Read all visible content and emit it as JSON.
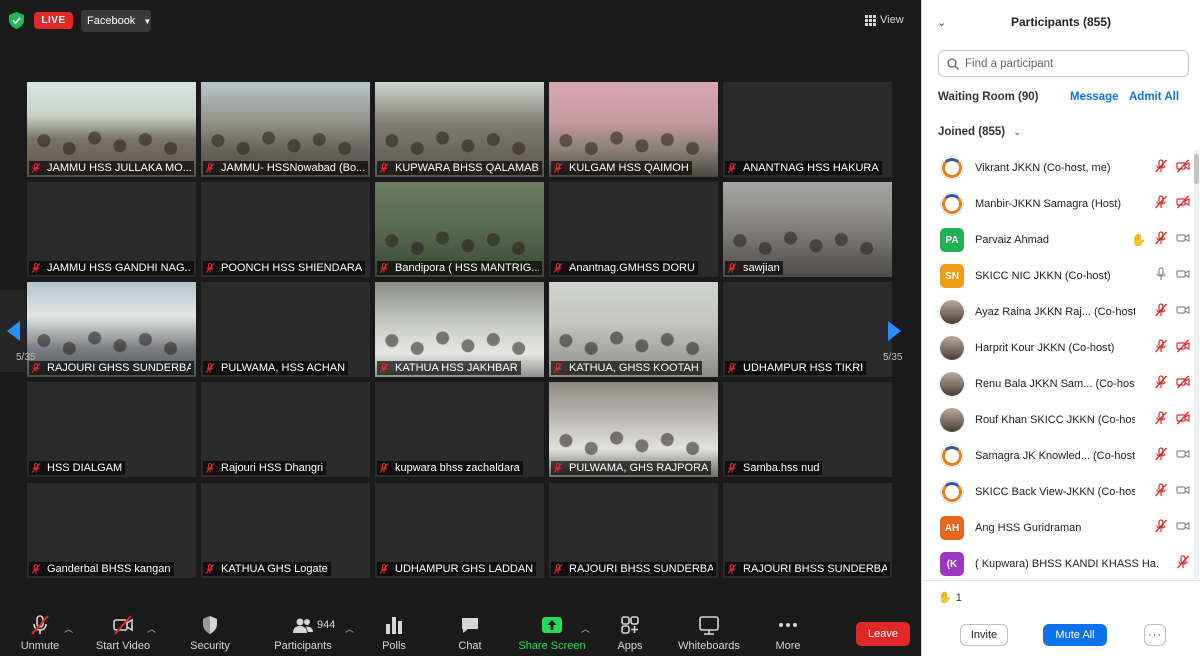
{
  "header": {
    "live_badge": "LIVE",
    "stream_target": "Facebook",
    "view_label": "View"
  },
  "pagination": {
    "left": "5/35",
    "right": "5/35"
  },
  "tiles": [
    {
      "name": "JAMMU HSS JULLAKA MO...",
      "video": "vid1",
      "muted": true
    },
    {
      "name": "JAMMU- HSSNowabad (Bo...",
      "video": "vid2",
      "muted": true
    },
    {
      "name": "KUPWARA BHSS QALAMAB...",
      "video": "vid3",
      "muted": true
    },
    {
      "name": "KULGAM HSS QAIMOH",
      "video": "vid4",
      "muted": true
    },
    {
      "name": "ANANTNAG HSS HAKURA",
      "video": "",
      "muted": true
    },
    {
      "name": "JAMMU HSS GANDHI NAG...",
      "video": "",
      "muted": true
    },
    {
      "name": "POONCH HSS SHIENDARA",
      "video": "",
      "muted": true
    },
    {
      "name": "Bandipora ( HSS MANTRIG...",
      "video": "vid5",
      "muted": true
    },
    {
      "name": "Anantnag.GMHSS DORU",
      "video": "",
      "muted": true
    },
    {
      "name": "sawjian",
      "video": "vid6",
      "muted": true
    },
    {
      "name": "RAJOURI GHSS SUNDERBA...",
      "video": "vid7",
      "muted": true
    },
    {
      "name": "PULWAMA, HSS ACHAN",
      "video": "",
      "muted": true
    },
    {
      "name": "KATHUA HSS JAKHBAR",
      "video": "vid8",
      "muted": true
    },
    {
      "name": "KATHUA, GHSS KOOTAH",
      "video": "vid9",
      "muted": true
    },
    {
      "name": "UDHAMPUR HSS TIKRI",
      "video": "",
      "muted": true
    },
    {
      "name": "HSS DIALGAM",
      "video": "",
      "muted": true
    },
    {
      "name": "Rajouri HSS Dhangri",
      "video": "",
      "muted": true
    },
    {
      "name": "kupwara bhss zachaldara",
      "video": "",
      "muted": true
    },
    {
      "name": "PULWAMA, GHS RAJPORA",
      "video": "vid10",
      "muted": true
    },
    {
      "name": "Samba.hss nud",
      "video": "",
      "muted": true
    },
    {
      "name": "Ganderbal BHSS kangan",
      "video": "",
      "muted": true
    },
    {
      "name": "KATHUA GHS Logate",
      "video": "",
      "muted": true
    },
    {
      "name": "UDHAMPUR GHS LADDAN",
      "video": "",
      "muted": true
    },
    {
      "name": "RAJOURI BHSS SUNDERBA...",
      "video": "",
      "muted": true
    },
    {
      "name": "RAJOURI BHSS SUNDERBA...",
      "video": "",
      "muted": true
    }
  ],
  "toolbar": {
    "unmute": "Unmute",
    "start_video": "Start Video",
    "security": "Security",
    "participants": "Participants",
    "participants_count": "944",
    "polls": "Polls",
    "chat": "Chat",
    "share_screen": "Share Screen",
    "apps": "Apps",
    "whiteboards": "Whiteboards",
    "more": "More",
    "leave": "Leave"
  },
  "panel": {
    "title": "Participants (855)",
    "search_placeholder": "Find a participant",
    "waiting_room": "Waiting Room (90)",
    "message": "Message",
    "admit_all": "Admit All",
    "joined": "Joined (855)",
    "raised_hands": "1",
    "invite": "Invite",
    "mute_all": "Mute All",
    "more": "···"
  },
  "participants": [
    {
      "name": "Vikrant JKKN (Co-host, me)",
      "avatar": "logo",
      "initials": "",
      "color": "",
      "hand": false,
      "mic": "muted",
      "video": "off"
    },
    {
      "name": "Manbir-JKKN Samagra (Host)",
      "avatar": "logo",
      "initials": "",
      "color": "",
      "hand": false,
      "mic": "muted",
      "video": "off"
    },
    {
      "name": "Parvaiz Ahmad",
      "avatar": "initials",
      "initials": "PA",
      "color": "#1fb254",
      "hand": true,
      "mic": "muted",
      "video": "on"
    },
    {
      "name": "SKICC NIC JKKN (Co-host)",
      "avatar": "initials",
      "initials": "SN",
      "color": "#f29a14",
      "hand": false,
      "mic": "on",
      "video": "on"
    },
    {
      "name": "Ayaz Raina JKKN Raj...  (Co-host)",
      "avatar": "photo",
      "initials": "",
      "color": "",
      "hand": false,
      "mic": "muted",
      "video": "on"
    },
    {
      "name": "Harprit Kour JKKN (Co-host)",
      "avatar": "photo",
      "initials": "",
      "color": "",
      "hand": false,
      "mic": "muted",
      "video": "off"
    },
    {
      "name": "Renu Bala JKKN Sam...  (Co-host)",
      "avatar": "photo",
      "initials": "",
      "color": "",
      "hand": false,
      "mic": "muted",
      "video": "off"
    },
    {
      "name": "Rouf Khan SKICC JKKN (Co-host)",
      "avatar": "photo",
      "initials": "",
      "color": "",
      "hand": false,
      "mic": "muted",
      "video": "off"
    },
    {
      "name": "Samagra JK Knowled...  (Co-host)",
      "avatar": "logo",
      "initials": "",
      "color": "",
      "hand": false,
      "mic": "muted",
      "video": "on"
    },
    {
      "name": "SKICC Back View-JKKN (Co-host)",
      "avatar": "logo",
      "initials": "",
      "color": "",
      "hand": false,
      "mic": "muted",
      "video": "on"
    },
    {
      "name": "Ang HSS Guridraman",
      "avatar": "initials",
      "initials": "AH",
      "color": "#e5671e",
      "hand": false,
      "mic": "muted",
      "video": "on"
    },
    {
      "name": "( Kupwara) BHSS KANDI KHASS Ha...",
      "avatar": "initials",
      "initials": "(K",
      "color": "#9b36c7",
      "hand": false,
      "mic": "muted",
      "video": "none"
    }
  ],
  "colors": {
    "accent": "#0e72ed",
    "live": "#e02828",
    "leave": "#e02828",
    "share": "#23d959",
    "muted": "#e02828"
  }
}
